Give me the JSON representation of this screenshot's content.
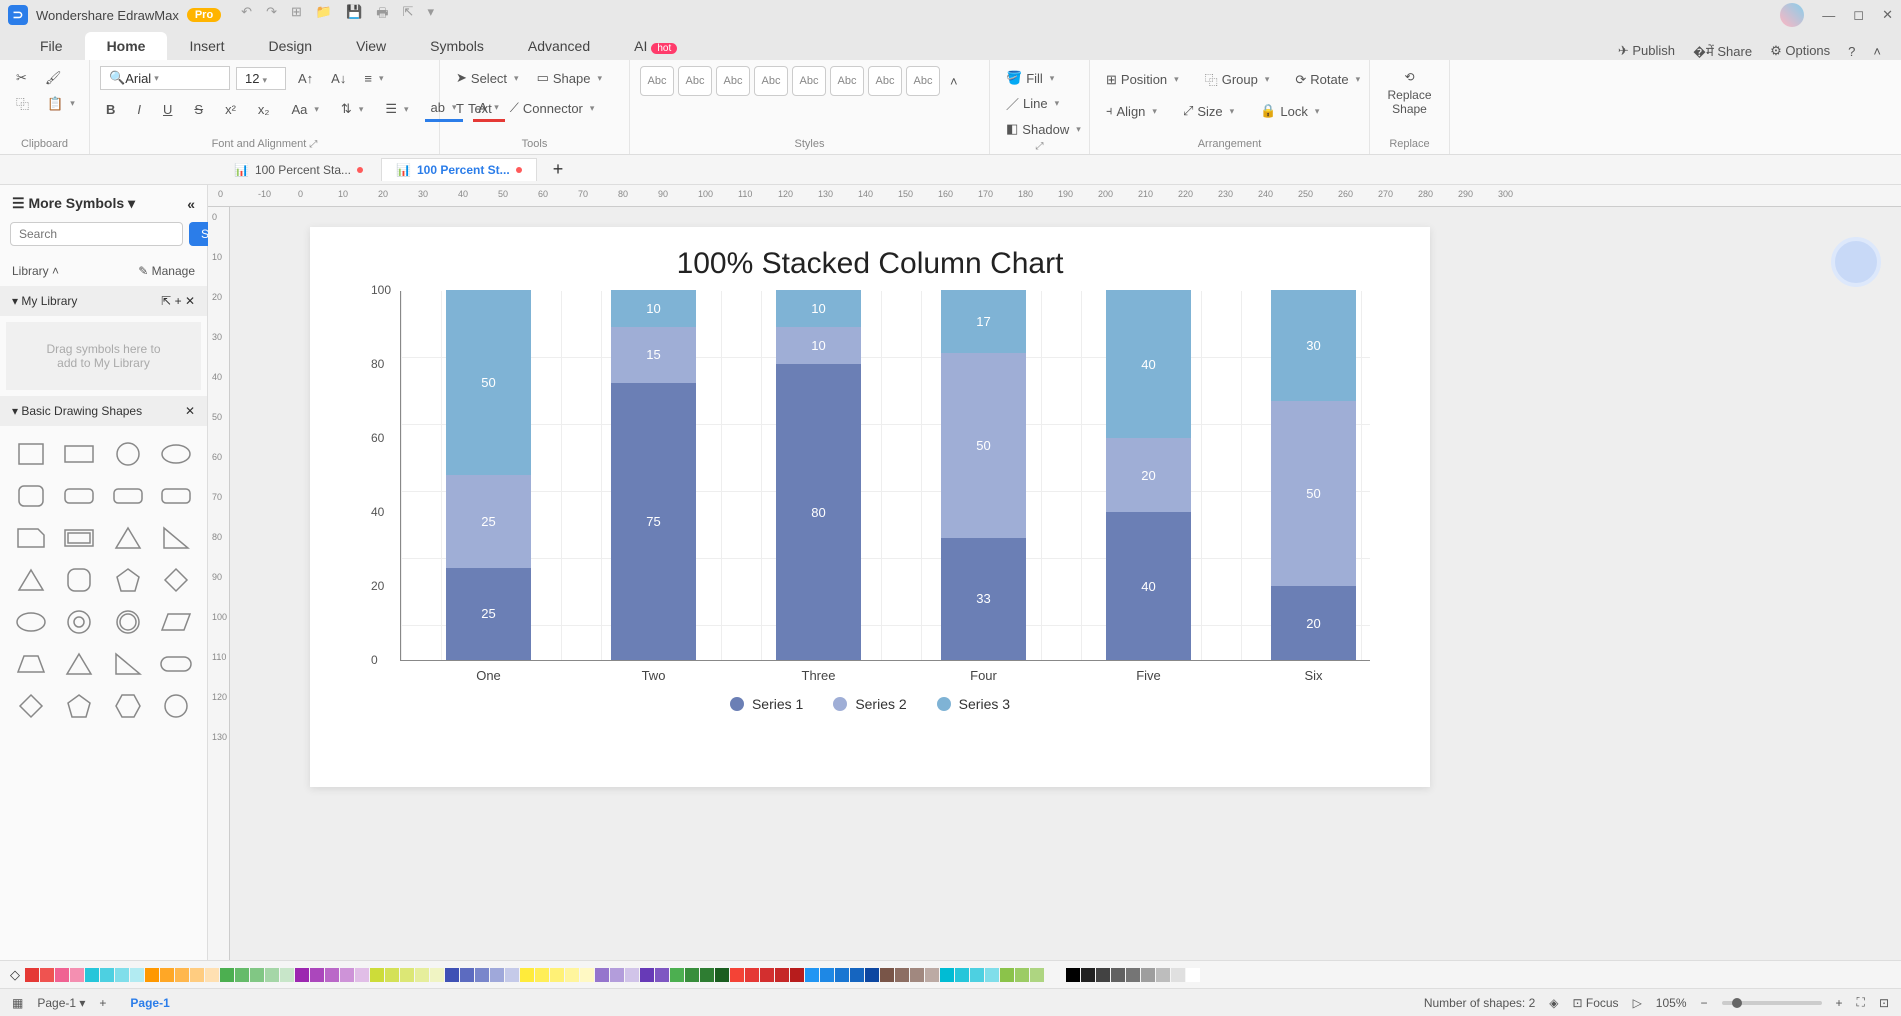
{
  "app": {
    "title": "Wondershare EdrawMax",
    "badge": "Pro"
  },
  "menu": {
    "tabs": [
      "File",
      "Home",
      "Insert",
      "Design",
      "View",
      "Symbols",
      "Advanced",
      "AI"
    ],
    "active": 1,
    "hot_on": "AI",
    "right": {
      "publish": "Publish",
      "share": "Share",
      "options": "Options"
    }
  },
  "ribbon": {
    "clipboard": {
      "label": "Clipboard"
    },
    "font": {
      "label": "Font and Alignment",
      "family": "Arial",
      "size": "12"
    },
    "tools": {
      "label": "Tools",
      "select": "Select",
      "shape": "Shape",
      "text": "Text",
      "connector": "Connector"
    },
    "styles": {
      "label": "Styles",
      "sample": "Abc"
    },
    "props": {
      "fill": "Fill",
      "line": "Line",
      "shadow": "Shadow"
    },
    "arrange": {
      "label": "Arrangement",
      "position": "Position",
      "group": "Group",
      "rotate": "Rotate",
      "align": "Align",
      "size": "Size",
      "lock": "Lock"
    },
    "replace": {
      "label": "Replace",
      "btn": "Replace Shape"
    }
  },
  "doctabs": [
    {
      "label": "100 Percent Sta...",
      "active": false
    },
    {
      "label": "100 Percent St...",
      "active": true
    }
  ],
  "sidebar": {
    "title": "More Symbols",
    "search_placeholder": "Search",
    "search_btn": "Search",
    "library": "Library",
    "manage": "Manage",
    "mylib": "My Library",
    "drag_hint": "Drag symbols here to add to My Library",
    "basic": "Basic Drawing Shapes"
  },
  "ruler_x": [
    "0",
    "-10",
    "0",
    "10",
    "20",
    "30",
    "40",
    "50",
    "60",
    "70",
    "80",
    "90",
    "100",
    "110",
    "120",
    "130",
    "140",
    "150",
    "160",
    "170",
    "180",
    "190",
    "200",
    "210",
    "220",
    "230",
    "240",
    "250",
    "260",
    "270",
    "280",
    "290",
    "300"
  ],
  "ruler_y": [
    "0",
    "10",
    "20",
    "30",
    "40",
    "50",
    "60",
    "70",
    "80",
    "90",
    "100",
    "110",
    "120",
    "130"
  ],
  "chart_data": {
    "type": "bar",
    "stacked": true,
    "percent": true,
    "title": "100% Stacked Column Chart",
    "categories": [
      "One",
      "Two",
      "Three",
      "Four",
      "Five",
      "Six"
    ],
    "series": [
      {
        "name": "Series 1",
        "color": "#6b7fb5",
        "values": [
          25,
          75,
          80,
          33,
          40,
          20
        ]
      },
      {
        "name": "Series 2",
        "color": "#9faed6",
        "values": [
          25,
          15,
          10,
          50,
          20,
          50
        ]
      },
      {
        "name": "Series 3",
        "color": "#7fb3d5",
        "values": [
          50,
          10,
          10,
          17,
          40,
          30
        ]
      }
    ],
    "yticks": [
      0,
      20,
      40,
      60,
      80,
      100
    ],
    "ylim": [
      0,
      100
    ]
  },
  "colors": [
    "#e53935",
    "#ef5350",
    "#f06292",
    "#f48fb1",
    "#26c6da",
    "#4dd0e1",
    "#80deea",
    "#b2ebf2",
    "#ff9800",
    "#ffa726",
    "#ffb74d",
    "#ffcc80",
    "#ffe0b2",
    "#4caf50",
    "#66bb6a",
    "#81c784",
    "#a5d6a7",
    "#c8e6c9",
    "#9c27b0",
    "#ab47bc",
    "#ba68c8",
    "#ce93d8",
    "#e1bee7",
    "#cddc39",
    "#d4e157",
    "#dce775",
    "#e6ee9c",
    "#f0f4c3",
    "#3f51b5",
    "#5c6bc0",
    "#7986cb",
    "#9fa8da",
    "#c5cae9",
    "#ffeb3b",
    "#ffee58",
    "#fff176",
    "#fff59d",
    "#fff9c4",
    "#9575cd",
    "#b39ddb",
    "#d1c4e9",
    "#673ab7",
    "#7e57c2",
    "#4caf50",
    "#388e3c",
    "#2e7d32",
    "#1b5e20",
    "#f44336",
    "#e53935",
    "#d32f2f",
    "#c62828",
    "#b71c1c",
    "#2196f3",
    "#1e88e5",
    "#1976d2",
    "#1565c0",
    "#0d47a1",
    "#795548",
    "#8d6e63",
    "#a1887f",
    "#bcaaa4",
    "#00bcd4",
    "#26c6da",
    "#4dd0e1",
    "#80deea",
    "#8bc34a",
    "#9ccc65",
    "#aed581"
  ],
  "grays": [
    "#000000",
    "#212121",
    "#424242",
    "#616161",
    "#757575",
    "#9e9e9e",
    "#bdbdbd",
    "#e0e0e0",
    "#ffffff"
  ],
  "status": {
    "page_sel": "Page-1",
    "page_tab": "Page-1",
    "shapes": "Number of shapes: 2",
    "focus": "Focus",
    "zoom": "105%"
  }
}
